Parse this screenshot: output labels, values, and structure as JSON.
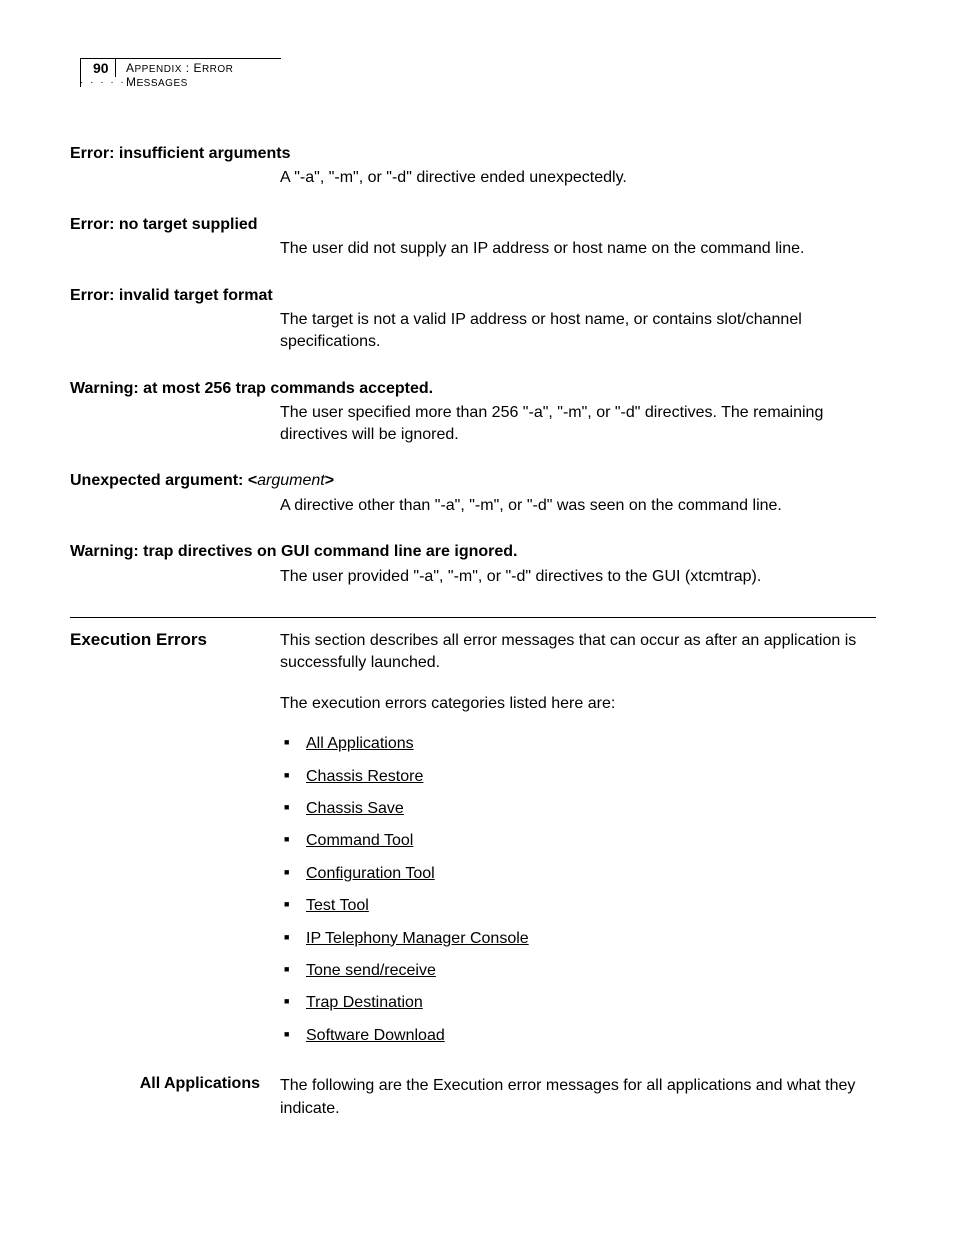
{
  "header": {
    "page_number": "90",
    "breadcrumb_prefix": "A",
    "breadcrumb_prefix_sc": "PPENDIX",
    "breadcrumb_separator": " : ",
    "breadcrumb_prefix2": "E",
    "breadcrumb_prefix2_sc": "RROR",
    "breadcrumb_prefix3": " M",
    "breadcrumb_prefix3_sc": "ESSAGES"
  },
  "entries": [
    {
      "title": "Error: insufficient arguments",
      "desc": "A \"-a\", \"-m\", or \"-d\" directive ended unexpectedly."
    },
    {
      "title": "Error: no target supplied",
      "desc": "The user did not supply an IP address or host name on the command line."
    },
    {
      "title": "Error: invalid target format",
      "desc": "The target is not a valid IP address or host name, or contains slot/channel specifications."
    },
    {
      "title": "Warning: at most 256 trap commands accepted.",
      "desc": "The user specified more than 256 \"-a\", \"-m\", or \"-d\" directives. The remaining directives will be ignored."
    },
    {
      "title_prefix": "Unexpected argument: <",
      "title_italic": "argument",
      "title_suffix": ">",
      "desc": "A directive other than \"-a\", \"-m\", or \"-d\" was seen on the command line."
    },
    {
      "title": "Warning: trap directives on GUI command line are ignored.",
      "desc": "The user provided \"-a\", \"-m\", or \"-d\" directives to the GUI (xtcmtrap)."
    }
  ],
  "section": {
    "heading": "Execution Errors",
    "intro1": "This section describes all error messages that can occur as after an application is successfully launched.",
    "intro2": "The execution errors categories listed here are:",
    "links": [
      "All Applications",
      "Chassis Restore",
      "Chassis Save",
      "Command Tool",
      "Configuration Tool",
      "Test Tool",
      "IP Telephony Manager Console",
      "Tone send/receive",
      "Trap Destination",
      "Software Download"
    ]
  },
  "subsection": {
    "heading": "All Applications",
    "body": "The following are the Execution error messages for all applications and what they indicate."
  }
}
